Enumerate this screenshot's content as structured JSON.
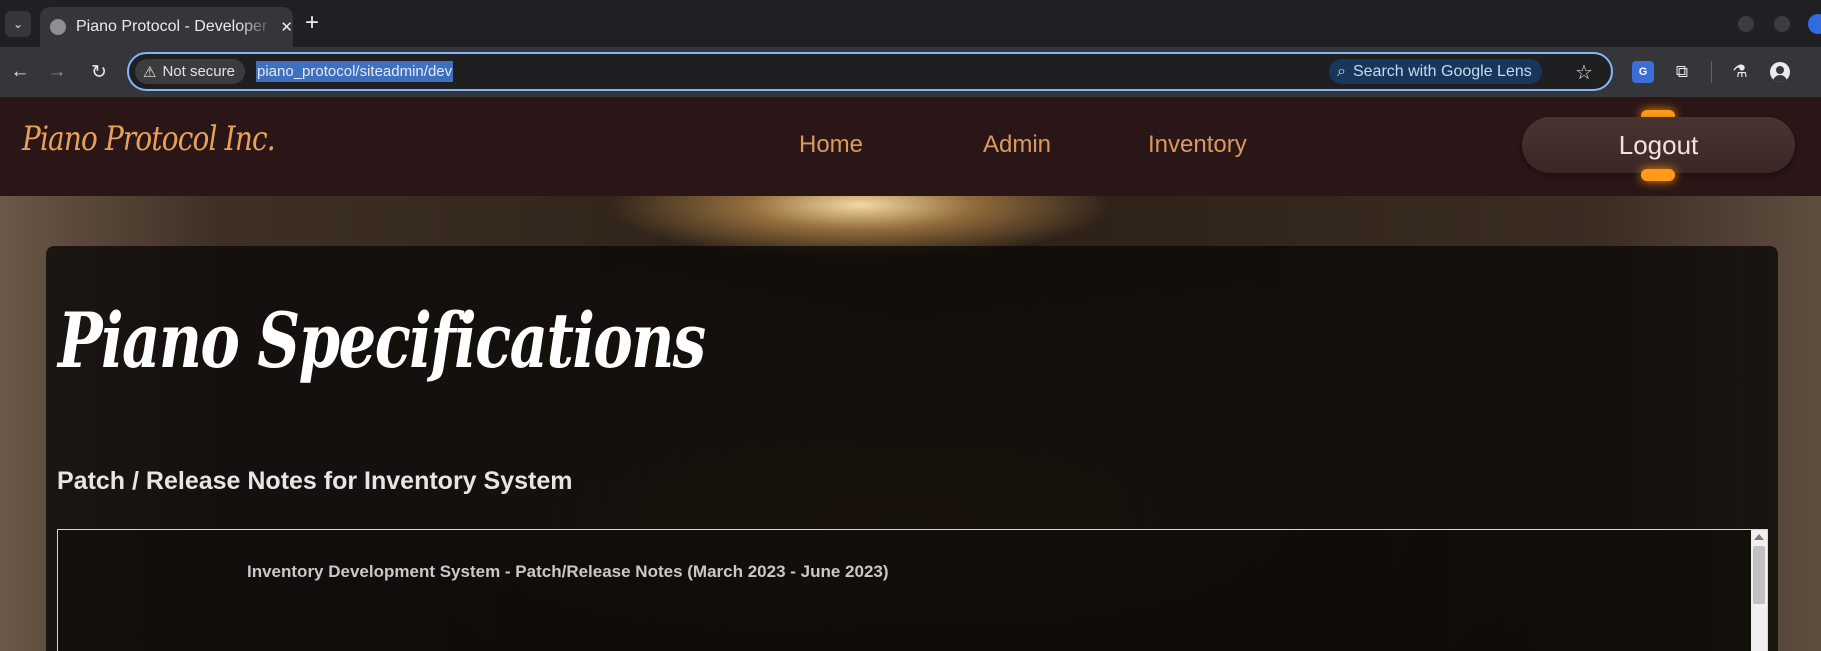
{
  "browser": {
    "tab_title": "Piano Protocol - Developer",
    "security_label": "Not secure",
    "url": "piano_protocol/siteadmin/dev",
    "lens_label": "Search with Google Lens"
  },
  "site": {
    "logo_text": "Piano Protocol Inc.",
    "nav": {
      "home": "Home",
      "admin": "Admin",
      "inventory": "Inventory"
    },
    "logout_label": "Logout"
  },
  "main": {
    "title": "Piano Specifications",
    "subtitle": "Patch / Release Notes for Inventory System",
    "notes_heading": "Inventory Development System - Patch/Release Notes (March 2023 - June 2023)"
  },
  "colors": {
    "header_bg": "#2a1616",
    "nav_link": "#d99a60",
    "logo": "#e8a15a",
    "url_highlight": "#3f6fbf"
  }
}
